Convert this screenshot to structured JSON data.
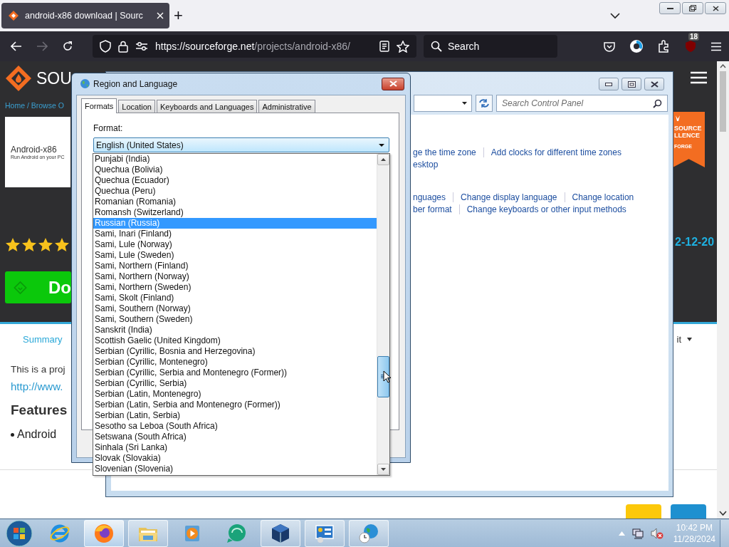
{
  "browser": {
    "tabs": [
      {
        "title": "android-x86 download | Sourc",
        "selected": true
      }
    ],
    "new_tab": "+",
    "nav": {
      "back_disabled": false,
      "forward_disabled": true
    },
    "url": {
      "host": "https://sourceforge.net",
      "path": "/projects/android-x86/"
    },
    "search": {
      "placeholder": "Search"
    },
    "extension_badge": "18"
  },
  "page": {
    "logo_text": "SOU",
    "breadcrumb": "Home / Browse O",
    "project": {
      "name": "Android-x86",
      "tagline": "Run Android on your PC"
    },
    "badge_texts": [
      "SOURCE",
      "LLENCE",
      "FORGE"
    ],
    "stars": 4,
    "date": "2-12-20",
    "download": "Do",
    "tabs": [
      {
        "label": "Summary",
        "selected": true,
        "dropdown": false
      },
      {
        "label": "it",
        "selected": false,
        "dropdown": true
      }
    ],
    "description": "This is a proj",
    "link": "http://www.",
    "features_heading": "Features",
    "features": [
      "Android"
    ]
  },
  "control_panel": {
    "search": {
      "placeholder": "Search Control Panel"
    },
    "link_rows": [
      [
        "ge the time zone",
        "Add clocks for different time zones"
      ],
      [
        "esktop"
      ],
      [
        "nguages",
        "Change display language",
        "Change location"
      ],
      [
        "ber format",
        "Change keyboards or other input methods"
      ]
    ]
  },
  "dialog": {
    "title": "Region and Language",
    "tabs": [
      {
        "label": "Formats",
        "selected": true
      },
      {
        "label": "Location",
        "selected": false
      },
      {
        "label": "Keyboards and Languages",
        "selected": false
      },
      {
        "label": "Administrative",
        "selected": false
      }
    ],
    "format_label": "Format:",
    "format_value": "English (United States)",
    "options": [
      {
        "label": "Punjabi (India)",
        "selected": false
      },
      {
        "label": "Quechua (Bolivia)",
        "selected": false
      },
      {
        "label": "Quechua (Ecuador)",
        "selected": false
      },
      {
        "label": "Quechua (Peru)",
        "selected": false
      },
      {
        "label": "Romanian (Romania)",
        "selected": false
      },
      {
        "label": "Romansh (Switzerland)",
        "selected": false
      },
      {
        "label": "Russian (Russia)",
        "selected": true
      },
      {
        "label": "Sami, Inari (Finland)",
        "selected": false
      },
      {
        "label": "Sami, Lule (Norway)",
        "selected": false
      },
      {
        "label": "Sami, Lule (Sweden)",
        "selected": false
      },
      {
        "label": "Sami, Northern (Finland)",
        "selected": false
      },
      {
        "label": "Sami, Northern (Norway)",
        "selected": false
      },
      {
        "label": "Sami, Northern (Sweden)",
        "selected": false
      },
      {
        "label": "Sami, Skolt (Finland)",
        "selected": false
      },
      {
        "label": "Sami, Southern (Norway)",
        "selected": false
      },
      {
        "label": "Sami, Southern (Sweden)",
        "selected": false
      },
      {
        "label": "Sanskrit (India)",
        "selected": false
      },
      {
        "label": "Scottish Gaelic (United Kingdom)",
        "selected": false
      },
      {
        "label": "Serbian (Cyrillic, Bosnia and Herzegovina)",
        "selected": false
      },
      {
        "label": "Serbian (Cyrillic, Montenegro)",
        "selected": false
      },
      {
        "label": "Serbian (Cyrillic, Serbia and Montenegro (Former))",
        "selected": false
      },
      {
        "label": "Serbian (Cyrillic, Serbia)",
        "selected": false
      },
      {
        "label": "Serbian (Latin, Montenegro)",
        "selected": false
      },
      {
        "label": "Serbian (Latin, Serbia and Montenegro (Former))",
        "selected": false
      },
      {
        "label": "Serbian (Latin, Serbia)",
        "selected": false
      },
      {
        "label": "Sesotho sa Leboa (South Africa)",
        "selected": false
      },
      {
        "label": "Setswana (South Africa)",
        "selected": false
      },
      {
        "label": "Sinhala (Sri Lanka)",
        "selected": false
      },
      {
        "label": "Slovak (Slovakia)",
        "selected": false
      },
      {
        "label": "Slovenian (Slovenia)",
        "selected": false
      }
    ]
  },
  "taskbar": {
    "items": [
      {
        "kind": "ie",
        "running": false,
        "selected": false
      },
      {
        "kind": "firefox",
        "running": true,
        "selected": true
      },
      {
        "kind": "folder",
        "running": true,
        "selected": false
      },
      {
        "kind": "media",
        "running": false,
        "selected": false
      },
      {
        "kind": "chat",
        "running": false,
        "selected": false
      },
      {
        "kind": "cube",
        "running": true,
        "selected": false
      },
      {
        "kind": "panel",
        "running": true,
        "selected": false
      },
      {
        "kind": "globe",
        "running": true,
        "selected": false
      }
    ],
    "clock": {
      "time": "10:42 PM",
      "date": "11/28/2024"
    }
  }
}
